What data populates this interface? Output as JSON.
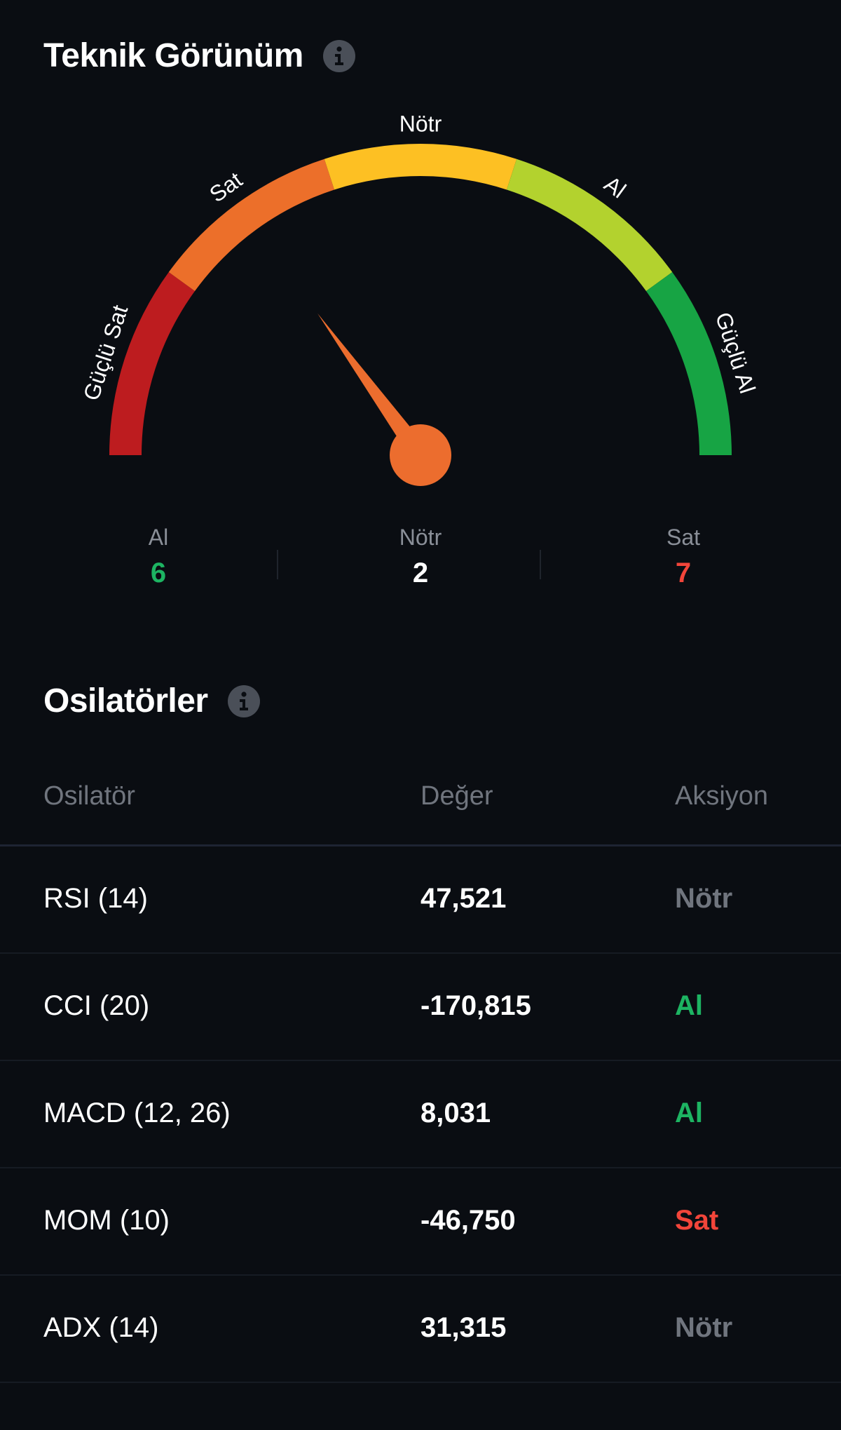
{
  "technical": {
    "title": "Teknik Görünüm",
    "gauge": {
      "labels": [
        "Güçlü Sat",
        "Sat",
        "Nötr",
        "Al",
        "Güçlü Al"
      ],
      "colors": [
        "#bd1c1f",
        "#ec6f2a",
        "#fdc023",
        "#b3d22e",
        "#17a444"
      ],
      "needle_color": "#ec6d2e",
      "needle_value_fraction": 0.3
    },
    "summary": {
      "buy_label": "Al",
      "buy_value": "6",
      "buy_color": "#1db462",
      "neutral_label": "Nötr",
      "neutral_value": "2",
      "sell_label": "Sat",
      "sell_value": "7",
      "sell_color": "#f2453a"
    }
  },
  "oscillators": {
    "title": "Osilatörler",
    "columns": {
      "name": "Osilatör",
      "value": "Değer",
      "action": "Aksiyon"
    },
    "rows": [
      {
        "name": "RSI (14)",
        "value": "47,521",
        "action": "Nötr",
        "action_color": "#70757e"
      },
      {
        "name": "CCI (20)",
        "value": "-170,815",
        "action": "Al",
        "action_color": "#1db462"
      },
      {
        "name": "MACD (12, 26)",
        "value": "8,031",
        "action": "Al",
        "action_color": "#1db462"
      },
      {
        "name": "MOM (10)",
        "value": "-46,750",
        "action": "Sat",
        "action_color": "#f2453a"
      },
      {
        "name": "ADX (14)",
        "value": "31,315",
        "action": "Nötr",
        "action_color": "#70757e"
      }
    ]
  },
  "icons": {
    "info": "info-icon"
  }
}
